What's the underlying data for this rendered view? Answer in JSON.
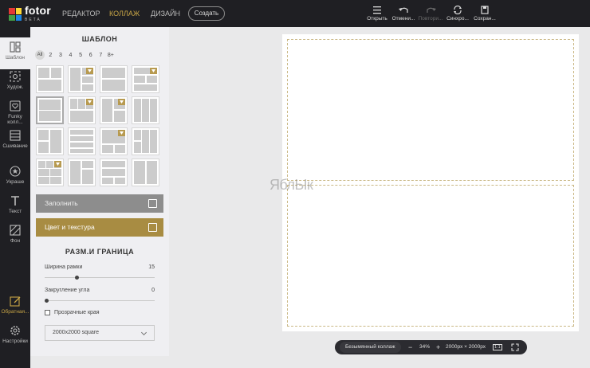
{
  "brand": {
    "name": "fotor",
    "tag": "BETA"
  },
  "nav": {
    "editor": "РЕДАКТОР",
    "collage": "КОЛЛАЖ",
    "design": "ДИЗАЙН",
    "create": "Создать"
  },
  "toolbar": {
    "open": "Открыть",
    "undo": "Отмени...",
    "redo": "Повтори...",
    "sync": "Синхро...",
    "save": "Сохран..."
  },
  "rail": {
    "template": "Шаблон",
    "art": "Худож.",
    "funky": "Funky колл...",
    "stitch": "Сшивание",
    "decor": "Украше",
    "text": "Текст",
    "bg": "Фон",
    "feedback": "Обратная...",
    "settings": "Настройки"
  },
  "panel": {
    "title": "ШАБЛОН",
    "counts": [
      "All",
      "2",
      "3",
      "4",
      "5",
      "6",
      "7",
      "8+"
    ],
    "fill_button": "Заполнить",
    "color_button": "Цвет и текстура",
    "size_title": "РАЗМ.И ГРАНИЦА",
    "border_width_label": "Ширина рамки",
    "border_width_value": "15",
    "corner_label": "Закругление угла",
    "corner_value": "0",
    "transparent_label": "Прозрачные края",
    "size_select": "2000x2000 square"
  },
  "canvas": {
    "watermark": "ЯблЫк"
  },
  "status": {
    "name": "Безымянный коллаж",
    "minus": "−",
    "zoom": "34%",
    "plus": "+",
    "dims": "2000px × 2000px",
    "ratio": "1:1"
  },
  "colors": {
    "dark": "#1f1f23",
    "gold": "#c9a646",
    "panel": "#efeff2"
  }
}
